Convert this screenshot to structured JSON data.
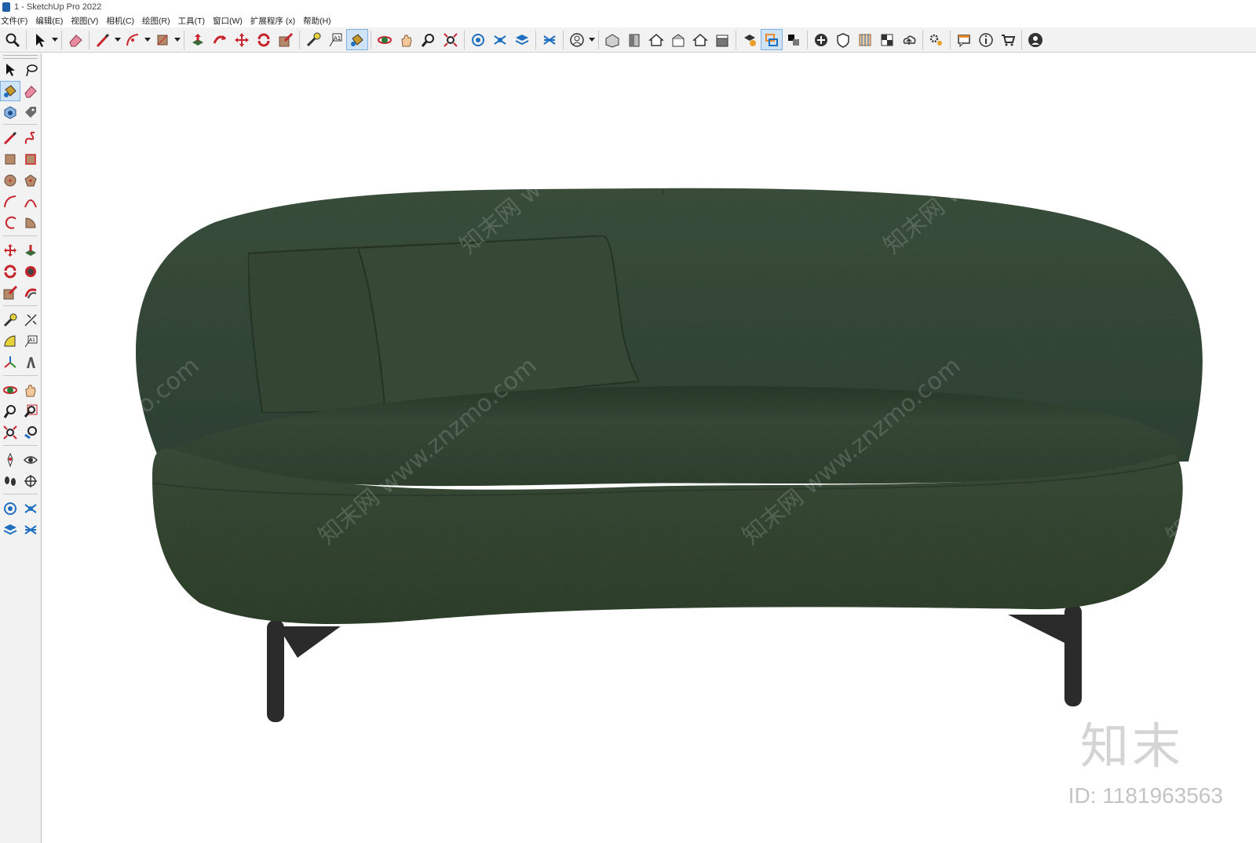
{
  "window": {
    "title": "1 - SketchUp Pro 2022"
  },
  "menubar": {
    "items": [
      "文件(F)",
      "编辑(E)",
      "视图(V)",
      "相机(C)",
      "绘图(R)",
      "工具(T)",
      "窗口(W)",
      "扩展程序 (x)",
      "帮助(H)"
    ]
  },
  "toolbar": {
    "tools": [
      "zoom-icon",
      "select-icon",
      "eraser-icon",
      "pencil-icon",
      "arc-icon",
      "rectangle-icon",
      "pushpull-icon",
      "followme-icon",
      "move-icon",
      "rotate-icon",
      "scale-icon",
      "tape-measure-icon",
      "text-icon",
      "paint-bucket-icon",
      "orbit-icon",
      "pan-icon",
      "zoom-window-icon",
      "zoom-extents-icon",
      "warehouse-icon",
      "extension-icon",
      "layers-icon",
      "sandbox-icon",
      "account-icon",
      "iso-view-icon",
      "front-view-icon",
      "top-view-icon",
      "right-view-icon",
      "back-view-icon",
      "left-view-icon",
      "solid-inspector-icon",
      "section-plane-icon",
      "section-display-icon",
      "add-location-icon",
      "shadow-icon",
      "fog-icon",
      "match-photo-icon",
      "upload-icon",
      "settings-icon",
      "message-icon",
      "info-icon",
      "cart-icon",
      "user-icon"
    ]
  },
  "colors": {
    "sofa_fabric": "#3a4d37",
    "sofa_shadow": "#2a3a28",
    "legs": "#2b2b2b",
    "accent_red": "#c8242b",
    "accent_blue": "#1f6fc0"
  },
  "watermark": {
    "text": "知末网 www.znzmo.com",
    "logo": "知末",
    "id_text": "ID: 1181963563"
  }
}
